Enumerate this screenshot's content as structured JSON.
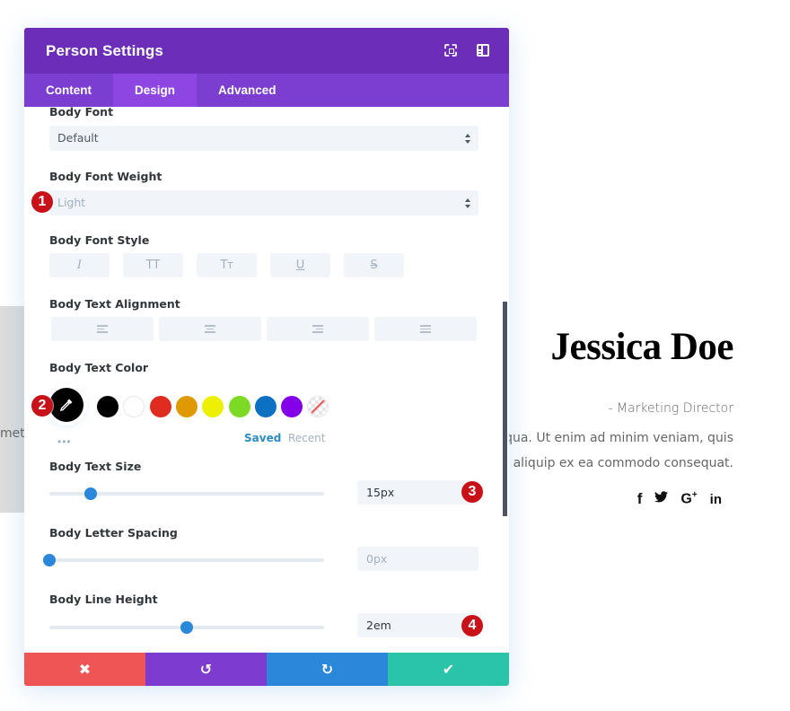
{
  "background_page": {
    "left_text_fragment": "met,",
    "person_name": "Jessica Doe",
    "person_role": "- Marketing Director",
    "body_lines": [
      "na aliqua. Ut enim ad minim veniam, quis",
      "isi ut aliquip ex ea commodo consequat."
    ],
    "social_icons": [
      {
        "name": "facebook-icon",
        "glyph": "f"
      },
      {
        "name": "twitter-icon",
        "glyph": "🐦"
      },
      {
        "name": "google-plus-icon",
        "glyph": "G+"
      },
      {
        "name": "linkedin-icon",
        "glyph": "in"
      }
    ]
  },
  "modal": {
    "title": "Person Settings",
    "header_icons": [
      "expand-icon",
      "split-view-icon"
    ],
    "tabs": [
      {
        "label": "Content",
        "active": false
      },
      {
        "label": "Design",
        "active": true
      },
      {
        "label": "Advanced",
        "active": false
      }
    ],
    "fields": {
      "body_font": {
        "label": "Body Font",
        "value": "Default"
      },
      "body_font_weight": {
        "label": "Body Font Weight",
        "value": "Light"
      },
      "body_font_style": {
        "label": "Body Font Style",
        "options": [
          {
            "name": "italic",
            "glyph": "I"
          },
          {
            "name": "uppercase",
            "glyph": "TT"
          },
          {
            "name": "small-caps",
            "glyph": "Tт"
          },
          {
            "name": "underline",
            "glyph": "U"
          },
          {
            "name": "strikethrough",
            "glyph": "S"
          }
        ]
      },
      "body_text_alignment": {
        "label": "Body Text Alignment",
        "options": [
          "left",
          "center",
          "right",
          "justify"
        ]
      },
      "body_text_color": {
        "label": "Body Text Color",
        "current": "#000000",
        "swatches": [
          "#000000",
          "#ffffff",
          "#e02b20",
          "#e09900",
          "#edf000",
          "#7cda24",
          "#0c71c3",
          "#8300e9",
          "transparent"
        ],
        "saved_label": "Saved",
        "recent_label": "Recent",
        "more_label": "•••"
      },
      "body_text_size": {
        "label": "Body Text Size",
        "value": "15px",
        "slider_fraction": 0.15
      },
      "body_letter_spacing": {
        "label": "Body Letter Spacing",
        "value": "0px",
        "slider_fraction": 0.0
      },
      "body_line_height": {
        "label": "Body Line Height",
        "value": "2em",
        "slider_fraction": 0.5
      }
    },
    "badges": [
      "1",
      "2",
      "3",
      "4"
    ],
    "footer": {
      "cancel": "✖",
      "undo": "↺",
      "redo": "↻",
      "save": "✔"
    },
    "colors": {
      "header": "#6c2eb9",
      "tabs": "#7b3ed1",
      "active_tab": "#8e46e2",
      "cancel": "#ef5555",
      "undo": "#7e3bd0",
      "redo": "#2b87da",
      "save": "#29c4a9",
      "badge": "#c9111a",
      "accent": "#2b87da"
    }
  }
}
